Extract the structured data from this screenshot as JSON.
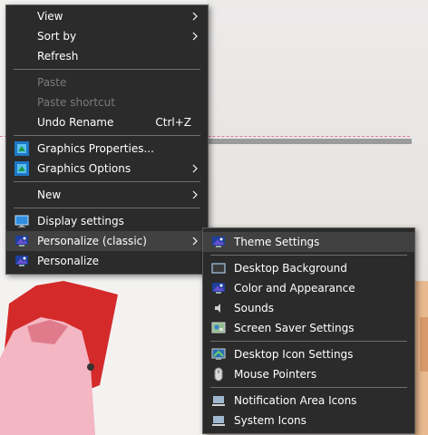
{
  "main_menu": {
    "items": [
      {
        "label": "View"
      },
      {
        "label": "Sort by"
      },
      {
        "label": "Refresh"
      },
      {
        "label": "Paste"
      },
      {
        "label": "Paste shortcut"
      },
      {
        "label": "Undo Rename",
        "shortcut": "Ctrl+Z"
      },
      {
        "label": "Graphics Properties..."
      },
      {
        "label": "Graphics Options"
      },
      {
        "label": "New"
      },
      {
        "label": "Display settings"
      },
      {
        "label": "Personalize (classic)"
      },
      {
        "label": "Personalize"
      }
    ]
  },
  "sub_menu": {
    "items": [
      {
        "label": "Theme Settings"
      },
      {
        "label": "Desktop Background"
      },
      {
        "label": "Color and Appearance"
      },
      {
        "label": "Sounds"
      },
      {
        "label": "Screen Saver Settings"
      },
      {
        "label": "Desktop Icon Settings"
      },
      {
        "label": "Mouse Pointers"
      },
      {
        "label": "Notification Area Icons"
      },
      {
        "label": "System Icons"
      }
    ]
  },
  "colors": {
    "menu_bg": "#2b2b2b",
    "menu_highlight": "#414141",
    "text": "#ffffff",
    "disabled_text": "#7a7a7a"
  }
}
